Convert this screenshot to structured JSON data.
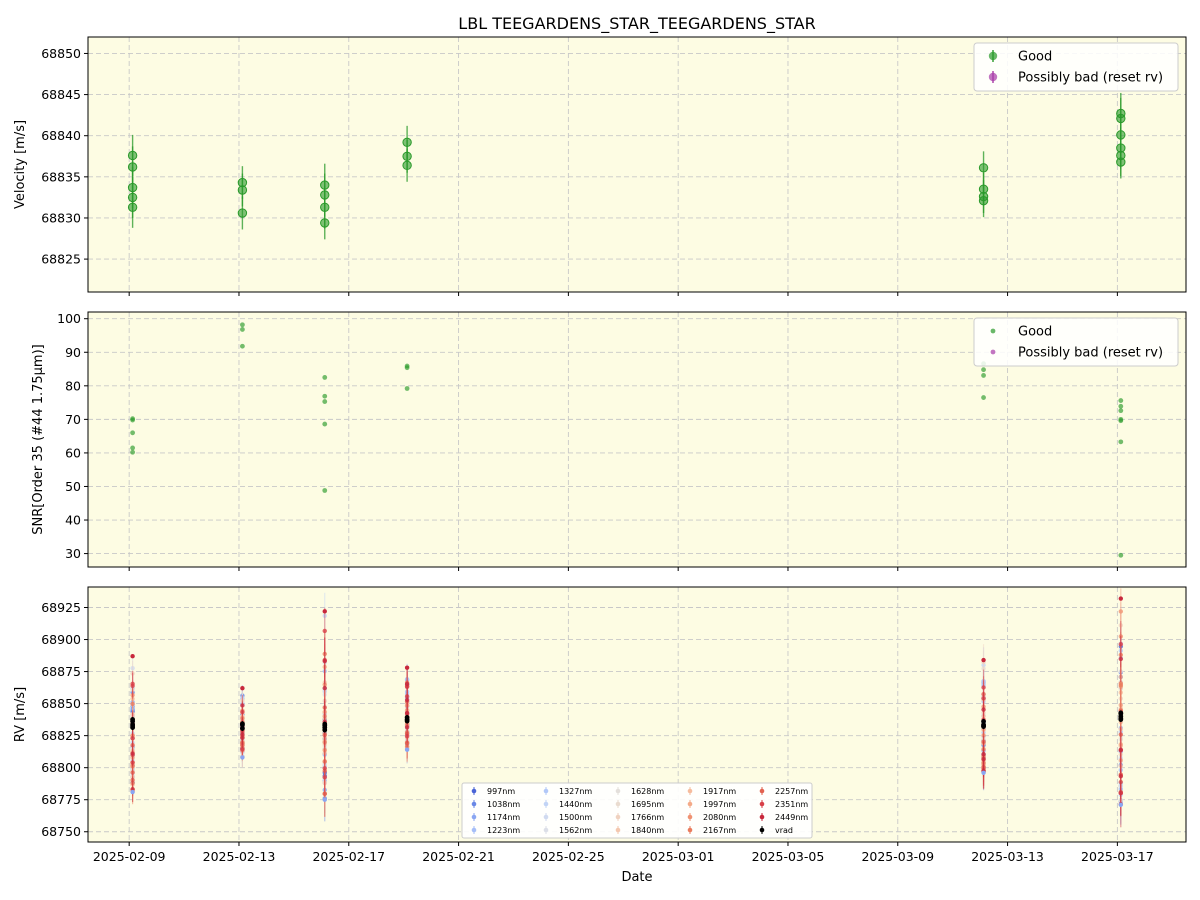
{
  "title": "LBL TEEGARDENS_STAR_TEEGARDENS_STAR",
  "colors": {
    "panel_bg": "#fdfce3",
    "good": "#2a9a2a",
    "bad": "#a83ba8",
    "grid": "#c8c8c8"
  },
  "chart_data": [
    {
      "type": "scatter",
      "panel": "velocity",
      "xlabel": "",
      "ylabel": "Velocity [m/s]",
      "ylim": [
        68821,
        68852
      ],
      "yticks": [
        68825,
        68830,
        68835,
        68840,
        68845,
        68850
      ],
      "grid": true,
      "legend_placement": "top-right",
      "legend": [
        "Good",
        "Possibly bad (reset rv)"
      ],
      "series": [
        {
          "name": "Good",
          "points": [
            {
              "x": "2025-02-09",
              "y": 68837.6,
              "err": 2.5
            },
            {
              "x": "2025-02-09",
              "y": 68836.2,
              "err": 2.5
            },
            {
              "x": "2025-02-09",
              "y": 68833.7,
              "err": 2.5
            },
            {
              "x": "2025-02-09",
              "y": 68832.5,
              "err": 2.5
            },
            {
              "x": "2025-02-09",
              "y": 68831.3,
              "err": 2.5
            },
            {
              "x": "2025-02-13",
              "y": 68834.3,
              "err": 2.0
            },
            {
              "x": "2025-02-13",
              "y": 68833.4,
              "err": 2.0
            },
            {
              "x": "2025-02-13",
              "y": 68830.6,
              "err": 2.0
            },
            {
              "x": "2025-02-16",
              "y": 68834.0,
              "err": 2.6
            },
            {
              "x": "2025-02-16",
              "y": 68832.8,
              "err": 2.6
            },
            {
              "x": "2025-02-16",
              "y": 68831.3,
              "err": 2.6
            },
            {
              "x": "2025-02-16",
              "y": 68829.4,
              "err": 2.0
            },
            {
              "x": "2025-02-19",
              "y": 68839.2,
              "err": 2.0
            },
            {
              "x": "2025-02-19",
              "y": 68837.5,
              "err": 2.0
            },
            {
              "x": "2025-02-19",
              "y": 68836.4,
              "err": 2.0
            },
            {
              "x": "2025-03-12",
              "y": 68836.1,
              "err": 2.0
            },
            {
              "x": "2025-03-12",
              "y": 68833.5,
              "err": 2.0
            },
            {
              "x": "2025-03-12",
              "y": 68832.6,
              "err": 2.0
            },
            {
              "x": "2025-03-12",
              "y": 68832.1,
              "err": 2.0
            },
            {
              "x": "2025-03-17",
              "y": 68842.7,
              "err": 2.5
            },
            {
              "x": "2025-03-17",
              "y": 68842.1,
              "err": 2.5
            },
            {
              "x": "2025-03-17",
              "y": 68840.1,
              "err": 2.5
            },
            {
              "x": "2025-03-17",
              "y": 68838.5,
              "err": 2.5
            },
            {
              "x": "2025-03-17",
              "y": 68837.6,
              "err": 2.5
            },
            {
              "x": "2025-03-17",
              "y": 68836.8,
              "err": 2.0
            }
          ]
        },
        {
          "name": "Possibly bad (reset rv)",
          "points": []
        }
      ]
    },
    {
      "type": "scatter",
      "panel": "snr",
      "xlabel": "",
      "ylabel": "SNR[Order 35 (#44 1.75μm)]",
      "ylim": [
        26,
        102
      ],
      "yticks": [
        30,
        40,
        50,
        60,
        70,
        80,
        90,
        100
      ],
      "grid": true,
      "legend_placement": "top-right",
      "legend": [
        "Good",
        "Possibly bad (reset rv)"
      ],
      "series": [
        {
          "name": "Good",
          "points": [
            {
              "x": "2025-02-09",
              "y": 70.2
            },
            {
              "x": "2025-02-09",
              "y": 69.8
            },
            {
              "x": "2025-02-09",
              "y": 66.0
            },
            {
              "x": "2025-02-09",
              "y": 61.5
            },
            {
              "x": "2025-02-09",
              "y": 60.2
            },
            {
              "x": "2025-02-13",
              "y": 98.2
            },
            {
              "x": "2025-02-13",
              "y": 96.8
            },
            {
              "x": "2025-02-13",
              "y": 91.8
            },
            {
              "x": "2025-02-16",
              "y": 82.5
            },
            {
              "x": "2025-02-16",
              "y": 76.9
            },
            {
              "x": "2025-02-16",
              "y": 75.3
            },
            {
              "x": "2025-02-16",
              "y": 68.6
            },
            {
              "x": "2025-02-16",
              "y": 48.8
            },
            {
              "x": "2025-02-19",
              "y": 85.9
            },
            {
              "x": "2025-02-19",
              "y": 85.4
            },
            {
              "x": "2025-02-19",
              "y": 79.2
            },
            {
              "x": "2025-03-12",
              "y": 86.6
            },
            {
              "x": "2025-03-12",
              "y": 84.8
            },
            {
              "x": "2025-03-12",
              "y": 83.1
            },
            {
              "x": "2025-03-12",
              "y": 76.5
            },
            {
              "x": "2025-03-17",
              "y": 75.6
            },
            {
              "x": "2025-03-17",
              "y": 73.9
            },
            {
              "x": "2025-03-17",
              "y": 72.6
            },
            {
              "x": "2025-03-17",
              "y": 70.0
            },
            {
              "x": "2025-03-17",
              "y": 69.6
            },
            {
              "x": "2025-03-17",
              "y": 63.3
            },
            {
              "x": "2025-03-17",
              "y": 29.5
            }
          ]
        },
        {
          "name": "Possibly bad (reset rv)",
          "points": []
        }
      ]
    },
    {
      "type": "scatter",
      "panel": "rv",
      "xlabel": "Date",
      "ylabel": "RV [m/s]",
      "ylim": [
        68742,
        68941
      ],
      "yticks": [
        68750,
        68775,
        68800,
        68825,
        68850,
        68875,
        68900,
        68925
      ],
      "xlim": [
        "2025-02-07T12:00",
        "2025-03-19T12:00"
      ],
      "xticks": [
        "2025-02-09",
        "2025-02-13",
        "2025-02-17",
        "2025-02-21",
        "2025-02-25",
        "2025-03-01",
        "2025-03-05",
        "2025-03-09",
        "2025-03-13",
        "2025-03-17"
      ],
      "grid": true,
      "legend_placement": "bottom-center",
      "legend_columns": [
        [
          "997nm",
          "1038nm",
          "1174nm",
          "1223nm"
        ],
        [
          "1327nm",
          "1440nm",
          "1500nm",
          "1562nm"
        ],
        [
          "1628nm",
          "1695nm",
          "1766nm",
          "1840nm"
        ],
        [
          "1917nm",
          "1997nm",
          "2080nm",
          "2167nm"
        ],
        [
          "2257nm",
          "2351nm",
          "2449nm",
          "vrad"
        ]
      ],
      "legend_colors": [
        [
          "#4a64d6",
          "#6a88e6",
          "#8aa6f2",
          "#a6bef8"
        ],
        [
          "#b2c8f8",
          "#c2d4f6",
          "#d0daf0",
          "#dcdfe8"
        ],
        [
          "#e4e0dc",
          "#eadcd0",
          "#f0d2c0",
          "#f4c8b0"
        ],
        [
          "#f6bc9e",
          "#f4aa88",
          "#f09272",
          "#ea7c5e"
        ],
        [
          "#e26250",
          "#d84048",
          "#c8283c",
          "#000000"
        ]
      ],
      "wavelength_series": [
        {
          "x": "2025-02-09",
          "min": 68781,
          "max": 68887,
          "err": 10
        },
        {
          "x": "2025-02-13",
          "min": 68808,
          "max": 68862,
          "err": 8
        },
        {
          "x": "2025-02-16",
          "min": 68775,
          "max": 68922,
          "err": 18
        },
        {
          "x": "2025-02-19",
          "min": 68814,
          "max": 68878,
          "err": 12
        },
        {
          "x": "2025-03-12",
          "min": 68796,
          "max": 68884,
          "err": 14
        },
        {
          "x": "2025-03-17",
          "min": 68771,
          "max": 68932,
          "err": 18
        }
      ],
      "vrad": [
        {
          "x": "2025-02-09",
          "values": [
            68837.6,
            68836.2,
            68833.7,
            68832.5,
            68831.3
          ]
        },
        {
          "x": "2025-02-13",
          "values": [
            68834.3,
            68833.4,
            68830.6
          ]
        },
        {
          "x": "2025-02-16",
          "values": [
            68834.0,
            68832.8,
            68831.3,
            68829.4
          ]
        },
        {
          "x": "2025-02-19",
          "values": [
            68839.2,
            68837.5,
            68836.4
          ]
        },
        {
          "x": "2025-03-12",
          "values": [
            68836.1,
            68833.5,
            68832.6,
            68832.1
          ]
        },
        {
          "x": "2025-03-17",
          "values": [
            68842.7,
            68842.1,
            68840.1,
            68838.5,
            68837.6
          ]
        }
      ]
    }
  ]
}
